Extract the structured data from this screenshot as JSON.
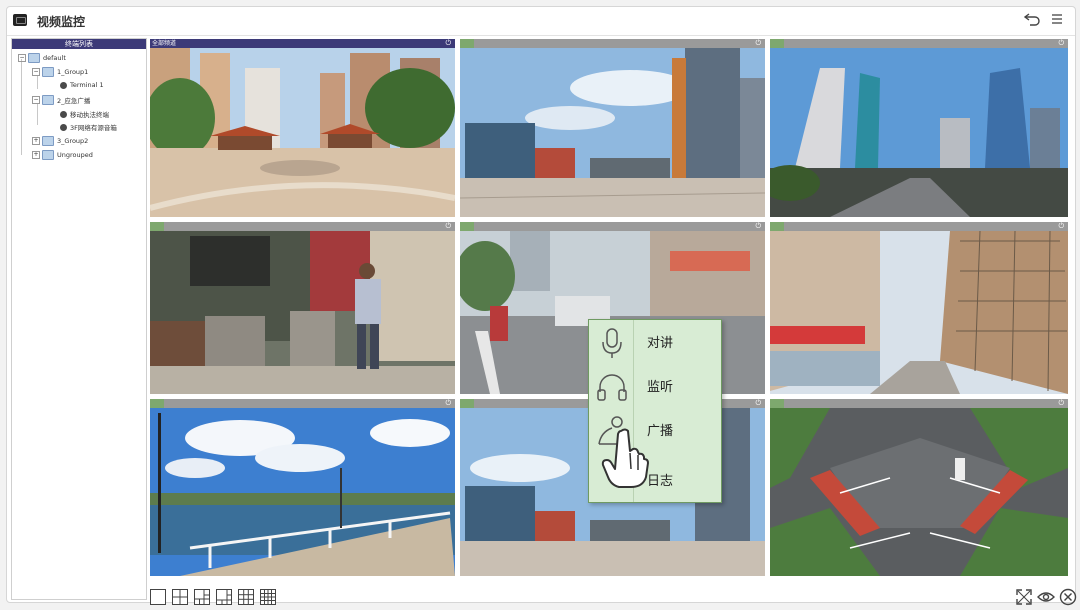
{
  "window": {
    "title": "视频监控"
  },
  "tree": {
    "header": "终端列表",
    "nodes": [
      {
        "label": "default",
        "level": 0,
        "type": "folder"
      },
      {
        "label": "1_Group1",
        "level": 1,
        "type": "folder"
      },
      {
        "label": "Terminal 1",
        "level": 2,
        "type": "terminal"
      },
      {
        "label": "2_应急广播",
        "level": 1,
        "type": "folder"
      },
      {
        "label": "移动执法终端",
        "level": 2,
        "type": "terminal"
      },
      {
        "label": "3F网络有源音箱",
        "level": 2,
        "type": "terminal"
      },
      {
        "label": "3_Group2",
        "level": 1,
        "type": "folder"
      },
      {
        "label": "Ungrouped",
        "level": 1,
        "type": "folder"
      }
    ]
  },
  "grid": {
    "cells": [
      {
        "id": "cell-1",
        "header_label": "全部频道",
        "active": true
      },
      {
        "id": "cell-2",
        "header_label": "",
        "active": false
      },
      {
        "id": "cell-3",
        "header_label": "",
        "active": false
      },
      {
        "id": "cell-4",
        "header_label": "",
        "active": false
      },
      {
        "id": "cell-5",
        "header_label": "",
        "active": false
      },
      {
        "id": "cell-6",
        "header_label": "",
        "active": false
      },
      {
        "id": "cell-7",
        "header_label": "",
        "active": false
      },
      {
        "id": "cell-8",
        "header_label": "",
        "active": false
      },
      {
        "id": "cell-9",
        "header_label": "",
        "active": false
      }
    ]
  },
  "context_menu": {
    "items": [
      {
        "label": "对讲",
        "icon": "microphone-icon"
      },
      {
        "label": "监听",
        "icon": "headphones-icon"
      },
      {
        "label": "广播",
        "icon": "speaker-icon"
      },
      {
        "label": "日志",
        "icon": "log-icon"
      }
    ]
  },
  "layout_options": [
    "1x1",
    "2x2",
    "1+3",
    "1+5",
    "3x3",
    "4x4"
  ],
  "colors": {
    "accent": "#3c3a78",
    "menu_bg": "#d8ecd4",
    "menu_border": "#6f9a62",
    "cell_bar": "#9a9a9a",
    "tag_green": "#7ea86e"
  }
}
